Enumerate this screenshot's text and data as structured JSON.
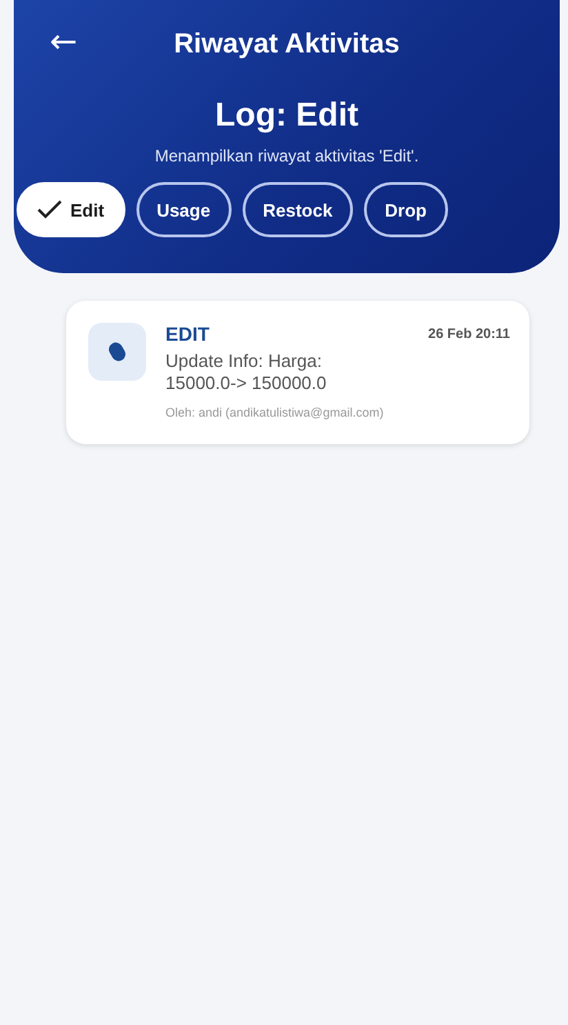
{
  "header": {
    "back": "←",
    "title": "Riwayat Aktivitas",
    "heading": "Log: Edit",
    "subtitle": "Menampilkan riwayat aktivitas 'Edit'."
  },
  "filters": [
    {
      "label": "Edit",
      "selected": true
    },
    {
      "label": "Usage",
      "selected": false
    },
    {
      "label": "Restock",
      "selected": false
    },
    {
      "label": "Drop",
      "selected": false
    }
  ],
  "logs": [
    {
      "type": "EDIT",
      "time": "26 Feb 20:11",
      "description": "Update Info: Harga: 15000.0-> 150000.0",
      "author": "Oleh: andi (andikatulistiwa@gmail.com)"
    }
  ]
}
